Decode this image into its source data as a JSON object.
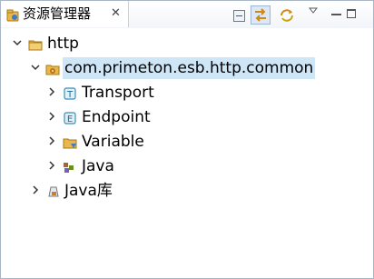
{
  "view": {
    "title": "资源管理器",
    "close_glyph": "✕",
    "icon": "explorer-icon"
  },
  "toolbar": {
    "collapse_all_icon": "collapse-all-icon",
    "link_editor_icon": "link-with-editor-icon",
    "sync_icon": "sync-icon",
    "menu_icon": "view-menu-icon",
    "minimize_icon": "minimize-icon",
    "maximize_icon": "maximize-icon"
  },
  "tree": {
    "project": {
      "label": "http",
      "expanded": true,
      "icon": "project-folder-icon"
    },
    "module": {
      "label": "com.primeton.esb.http.common",
      "expanded": true,
      "selected": true,
      "icon": "module-gear-folder-icon"
    },
    "children": [
      {
        "label": "Transport",
        "icon": "transport-icon",
        "expanded": false
      },
      {
        "label": "Endpoint",
        "icon": "endpoint-icon",
        "expanded": false
      },
      {
        "label": "Variable",
        "icon": "variable-folder-icon",
        "expanded": false
      },
      {
        "label": "Java",
        "icon": "java-package-icon",
        "expanded": false
      }
    ],
    "library": {
      "label": "Java库",
      "icon": "java-library-icon",
      "expanded": false
    }
  },
  "colors": {
    "selection": "#cfe6f7",
    "border": "#a9b6c6",
    "folder": "#e8b84a"
  }
}
